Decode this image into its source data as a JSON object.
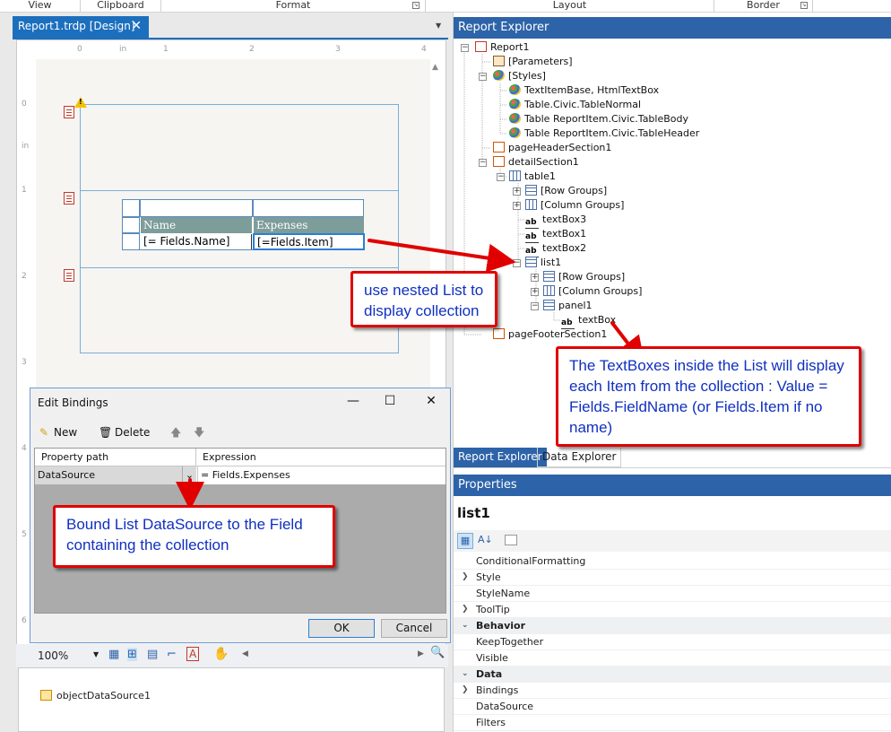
{
  "ribbon": {
    "groups": [
      "View",
      "Clipboard",
      "Format",
      "Layout",
      "Border"
    ]
  },
  "document": {
    "tab_label": "Report1.trdp [Design]",
    "close_glyph": "✕"
  },
  "ruler": {
    "top": [
      "0",
      "in",
      "1",
      "2",
      "3",
      "4"
    ],
    "left": [
      "0",
      "in",
      "1",
      "2",
      "3",
      "4",
      "5",
      "6"
    ]
  },
  "design_table": {
    "headers": [
      "Name",
      "Expenses"
    ],
    "cells": [
      "[= Fields.Name]",
      "[=Fields.Item]"
    ]
  },
  "callouts": {
    "nested_list": "use nested List to display collection",
    "textboxes": "The TextBoxes inside the List will display each Item from the collection : Value = Fields.FieldName (or Fields.Item if no name)",
    "datasource": "Bound List DataSource to the Field containing the collection"
  },
  "dialog": {
    "title": "Edit Bindings",
    "toolbar": {
      "new_label": "New",
      "delete_label": "Delete"
    },
    "columns": [
      "Property path",
      "Expression"
    ],
    "row": {
      "property_path": "DataSource",
      "expression": "= Fields.Expenses"
    },
    "ok_label": "OK",
    "cancel_label": "Cancel"
  },
  "zoom": {
    "level": "100%"
  },
  "component_tray": {
    "item": "objectDataSource1"
  },
  "report_explorer": {
    "title": "Report Explorer",
    "nodes": [
      {
        "label": "Report1"
      },
      {
        "label": "[Parameters]"
      },
      {
        "label": "[Styles]"
      },
      {
        "label": "TextItemBase, HtmlTextBox"
      },
      {
        "label": "Table.Civic.TableNormal"
      },
      {
        "label": "Table ReportItem.Civic.TableBody"
      },
      {
        "label": "Table ReportItem.Civic.TableHeader"
      },
      {
        "label": "pageHeaderSection1"
      },
      {
        "label": "detailSection1"
      },
      {
        "label": "table1"
      },
      {
        "label": "[Row Groups]"
      },
      {
        "label": "[Column Groups]"
      },
      {
        "label": "textBox3"
      },
      {
        "label": "textBox1"
      },
      {
        "label": "textBox2"
      },
      {
        "label": "list1"
      },
      {
        "label": "[Row Groups]"
      },
      {
        "label": "[Column Groups]"
      },
      {
        "label": "panel1"
      },
      {
        "label": "textBox"
      },
      {
        "label": "pageFooterSection1"
      }
    ]
  },
  "explorer_tabs": [
    "Report Explorer",
    "Data Explorer"
  ],
  "properties": {
    "title": "Properties",
    "selected_object": "list1",
    "rows": [
      {
        "label": "ConditionalFormatting"
      },
      {
        "label": "Style"
      },
      {
        "label": "StyleName"
      },
      {
        "label": "ToolTip"
      },
      {
        "label": "Behavior"
      },
      {
        "label": "KeepTogether"
      },
      {
        "label": "Visible"
      },
      {
        "label": "Data"
      },
      {
        "label": "Bindings"
      },
      {
        "label": "DataSource"
      },
      {
        "label": "Filters"
      }
    ]
  },
  "colors": {
    "accent": "#2d63a8",
    "doc_tab": "#1c6fbd",
    "callout_border": "#e00000",
    "callout_text": "#1030c0",
    "table_header": "#7d9d9a"
  }
}
